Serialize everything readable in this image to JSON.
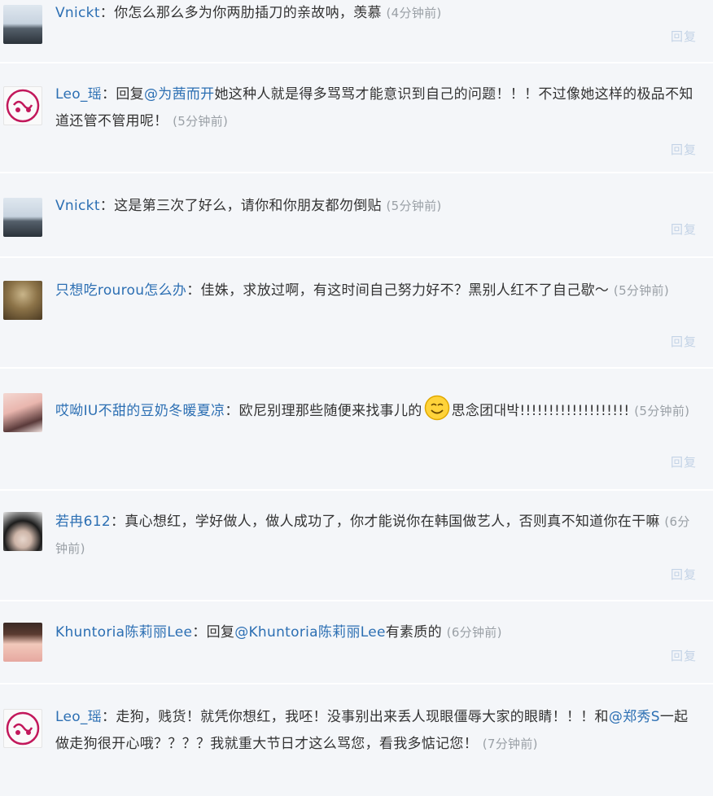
{
  "reply_label": "回复",
  "comments": [
    {
      "avatar": "landscape",
      "author": "Vnickt",
      "segments": [
        {
          "t": "你怎么那么多为你两肋插刀的亲故呐，羡慕"
        }
      ],
      "time": "(4分钟前)"
    },
    {
      "avatar": "leo-logo",
      "author": "Leo_瑶",
      "segments": [
        {
          "t": "回复"
        },
        {
          "m": "@为茜而开"
        },
        {
          "t": "她这种人就是得多骂骂才能意识到自己的问题！！！不过像她这样的极品不知道还管不管用呢！"
        }
      ],
      "time": "(5分钟前)"
    },
    {
      "avatar": "landscape",
      "author": "Vnickt",
      "segments": [
        {
          "t": "这是第三次了好么，请你和你朋友都勿倒贴"
        }
      ],
      "time": "(5分钟前)"
    },
    {
      "avatar": "statue",
      "author": "只想吃rourou怎么办",
      "segments": [
        {
          "t": "佳姝，求放过啊，有这时间自己努力好不？黑别人红不了自己歇～"
        }
      ],
      "time": "(5分钟前)"
    },
    {
      "avatar": "girl",
      "author": "哎呦IU不甜的豆奶冬暖夏凉",
      "segments": [
        {
          "t": "欧尼别理那些随便来找事儿的"
        },
        {
          "e": "smile-emoji"
        },
        {
          "t": "思念团대박!!!!!!!!!!!!!!!!!!!"
        }
      ],
      "time": "(5分钟前)"
    },
    {
      "avatar": "cat-girl",
      "author": "若冉612",
      "segments": [
        {
          "t": "真心想红，学好做人，做人成功了，你才能说你在韩国做艺人，否则真不知道你在干嘛"
        }
      ],
      "time": "(6分钟前)"
    },
    {
      "avatar": "girl",
      "author": "Khuntoria陈莉丽Lee",
      "segments": [
        {
          "t": "回复"
        },
        {
          "m": "@Khuntoria陈莉丽Lee"
        },
        {
          "t": "有素质的"
        }
      ],
      "time": "(6分钟前)"
    },
    {
      "avatar": "leo-logo",
      "author": "Leo_瑶",
      "segments": [
        {
          "t": "走狗，贱货！就凭你想红，我呸！没事别出来丢人现眼僵辱大家的眼睛！！！和"
        },
        {
          "m": "@郑秀S"
        },
        {
          "t": "一起做走狗很开心哦？？？？我就重大节日才这么骂您，看我多惦记您！"
        }
      ],
      "time": "(7分钟前)"
    }
  ]
}
